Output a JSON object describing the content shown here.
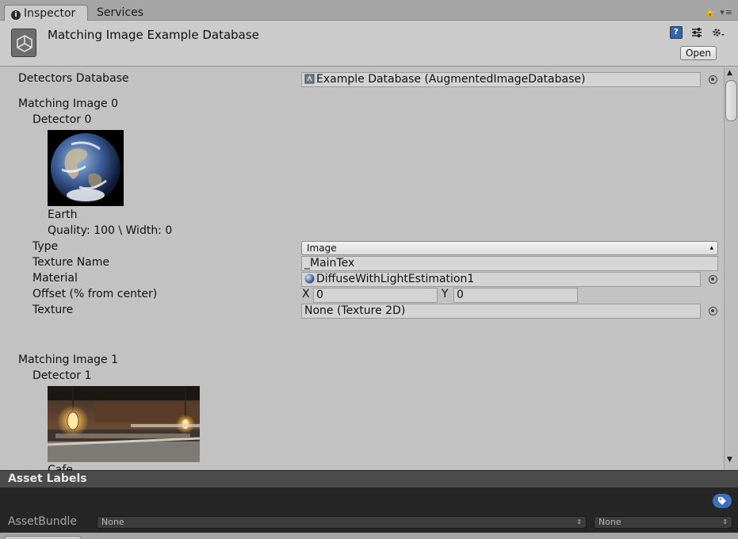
{
  "tabs": [
    {
      "label": "Inspector",
      "active": true,
      "icon": "info-icon"
    },
    {
      "label": "Services",
      "active": false
    }
  ],
  "header": {
    "title": "Matching Image Example Database",
    "open_label": "Open",
    "icons": [
      "unity-logo-icon",
      "help-book-icon",
      "presets-icon",
      "gear-icon"
    ]
  },
  "detectors_database": {
    "label": "Detectors Database",
    "value": "Example Database (AugmentedImageDatabase)"
  },
  "matching_images": [
    {
      "title": "Matching Image 0",
      "detector_label": "Detector 0",
      "image_name": "Earth",
      "quality": "Quality: 100 \\ Width: 0",
      "fields": {
        "type_label": "Type",
        "type_value": "Image",
        "texture_name_label": "Texture Name",
        "texture_name_value": "_MainTex",
        "material_label": "Material",
        "material_value": "DiffuseWithLightEstimation1",
        "offset_label": "Offset (% from center)",
        "offset_x_label": "X",
        "offset_x_value": "0",
        "offset_y_label": "Y",
        "offset_y_value": "0",
        "texture_label": "Texture",
        "texture_value": "None (Texture 2D)"
      }
    },
    {
      "title": "Matching Image 1",
      "detector_label": "Detector 1",
      "image_name": "Cafe"
    }
  ],
  "asset_labels": {
    "title": "Asset Labels",
    "bundle_label": "AssetBundle",
    "bundle_value": "None",
    "variant_value": "None"
  },
  "colors": {
    "panel_bg": "#c2c2c2",
    "header_bg": "#cbcbcb",
    "dark_bg": "#262626",
    "accent": "#3c6fbd"
  }
}
